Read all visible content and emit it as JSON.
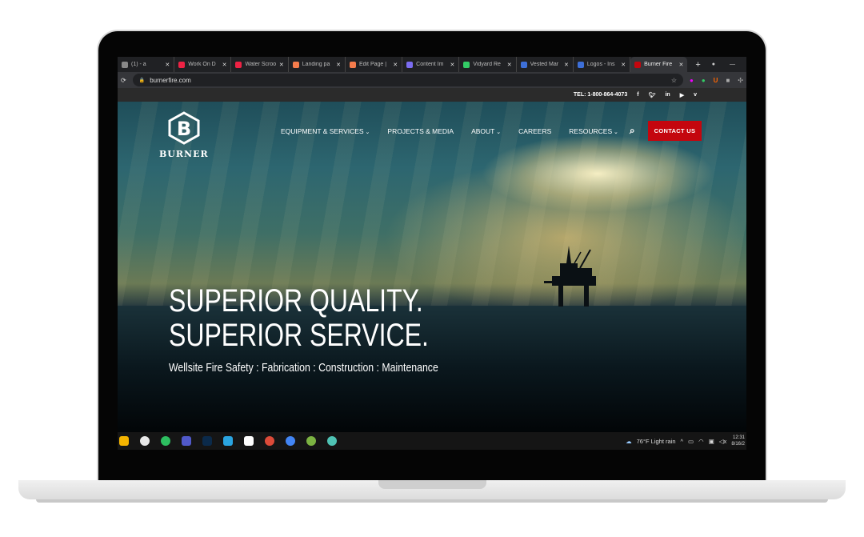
{
  "browser": {
    "tabs": [
      {
        "label": "(1) - a",
        "color": "#888"
      },
      {
        "label": "Work On D",
        "color": "#e24"
      },
      {
        "label": "Water Scroo",
        "color": "#e24"
      },
      {
        "label": "Landing pa",
        "color": "#f57c4c"
      },
      {
        "label": "Edit Page |",
        "color": "#f57c4c"
      },
      {
        "label": "Content Im",
        "color": "#7b6cf0"
      },
      {
        "label": "Vidyard Re",
        "color": "#3c6"
      },
      {
        "label": "Vested Mar",
        "color": "#3d6fd8"
      },
      {
        "label": "Logos - Ins",
        "color": "#3d6fd8"
      },
      {
        "label": "Burner Fire",
        "color": "#c4060e"
      }
    ],
    "new_tab": "+",
    "url": "burnerfire.com",
    "minimize": "—"
  },
  "site": {
    "phone": "TEL: 1-800-864-4073",
    "social": [
      "f",
      "t",
      "in",
      "yt",
      "v"
    ],
    "logo_text": "BURNER",
    "nav": [
      {
        "label": "EQUIPMENT & SERVICES",
        "dropdown": true
      },
      {
        "label": "PROJECTS & MEDIA",
        "dropdown": false
      },
      {
        "label": "ABOUT",
        "dropdown": true
      },
      {
        "label": "CAREERS",
        "dropdown": false
      },
      {
        "label": "RESOURCES",
        "dropdown": true
      }
    ],
    "contact": "CONTACT US",
    "accent": "#c4060e",
    "headline1": "SUPERIOR QUALITY.",
    "headline2": "SUPERIOR SERVICE.",
    "subtitle": "Wellsite Fire Safety : Fabrication : Construction : Maintenance"
  },
  "taskbar": {
    "apps": [
      {
        "name": "files",
        "color": "#f4b400"
      },
      {
        "name": "slack",
        "color": "#e8e8e8"
      },
      {
        "name": "evernote",
        "color": "#2dbe60"
      },
      {
        "name": "teams",
        "color": "#5059c9"
      },
      {
        "name": "photoshop",
        "color": "#0b2a4a"
      },
      {
        "name": "azure",
        "color": "#2aa4e0"
      },
      {
        "name": "app",
        "color": "#fff"
      },
      {
        "name": "chrome",
        "color": "#dd4b39"
      },
      {
        "name": "chrome-profile",
        "color": "#4285f4"
      },
      {
        "name": "app-green",
        "color": "#7cb342"
      },
      {
        "name": "app-teal",
        "color": "#4fc3b4"
      }
    ],
    "weather": "76°F  Light rain",
    "time": "12:31",
    "date": "8/16/2"
  }
}
